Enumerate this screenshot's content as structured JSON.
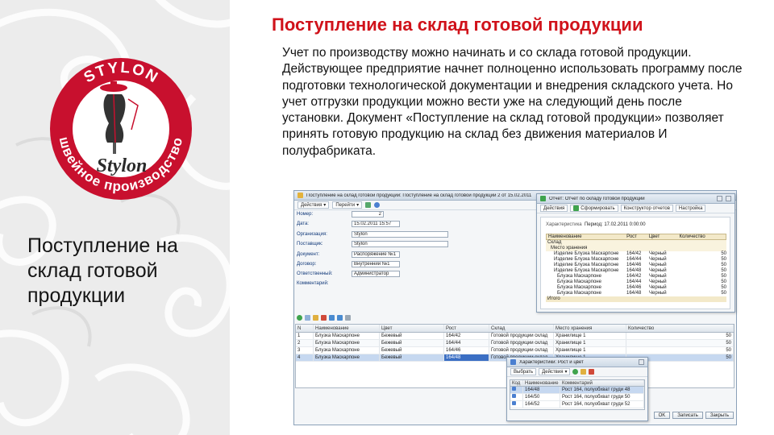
{
  "slide": {
    "title": "Поступление на склад готовой продукции",
    "side_title": "Поступление на склад готовой продукции",
    "body": "Учет по производству можно начинать и со склада готовой продукции. Действующее предприятие начнет полноценно использовать программу после подготовки технологической документации и внедрения складского учета. Но учет отгрузки продукции можно вести уже на следующий день после установки. Документ «Поступление на склад готовой продукции» позволяет принять готовую продукцию на склад без движения материалов И полуфабриката.",
    "accent_color": "#d0121a"
  },
  "logo": {
    "brand_top": "STYLON",
    "brand_script": "Stylon",
    "ring_text": "швейное производство",
    "ring_color": "#c8102e"
  },
  "doc_window": {
    "title": "Поступление на склад готовой продукции: Поступление на склад готовой продукции 2 от 15.02.2011",
    "toolbar": [
      "Действия",
      "Перейти"
    ],
    "fields": [
      {
        "label": "Номер:",
        "value": "2"
      },
      {
        "label": "Дата:",
        "value": "15.02.2011 15:57"
      },
      {
        "label": "Организация:",
        "value": "Stylon"
      },
      {
        "label": "Поставщик:",
        "value": "Stylon"
      },
      {
        "label": "Документ:",
        "value": "Распоряжение №1"
      },
      {
        "label": "Договор:",
        "value": "Внутренний №1"
      },
      {
        "label": "Ответственный:",
        "value": "Администратор"
      },
      {
        "label": "Комментарий:",
        "value": ""
      }
    ],
    "grid_headers": [
      "N",
      "Наименование",
      "Цвет",
      "Рост",
      "Склад",
      "Место хранения",
      "Количество"
    ],
    "grid_rows": [
      [
        "1",
        "Блузка Маскарпоне",
        "Бежевый",
        "164/42",
        "Готовой продукции склад",
        "Хранилище 1",
        "50"
      ],
      [
        "2",
        "Блузка Маскарпоне",
        "Бежевый",
        "164/44",
        "Готовой продукции склад",
        "Хранилище 1",
        "50"
      ],
      [
        "3",
        "Блузка Маскарпоне",
        "Бежевый",
        "164/46",
        "Готовой продукции склад",
        "Хранилище 1",
        "50"
      ],
      [
        "4",
        "Блузка Маскарпоне",
        "Бежевый",
        "164/48",
        "Готовой продукции склад",
        "Хранилище 1",
        "50"
      ]
    ]
  },
  "report_window": {
    "title": "Отчет: Отчет по складу готовой продукции",
    "toolbar": [
      "Действия",
      "Сформировать",
      "Конструктор отчетов",
      "Настройка"
    ],
    "period_label": "Характеристика",
    "period_value": "Период: 17.02.2011 0:00:00",
    "headers": [
      "Наименование",
      "Рост",
      "Цвет",
      "Количество"
    ],
    "groups": [
      "Склад",
      "Место хранения"
    ],
    "rows": [
      [
        "Изделие Блузка Маскарпоне",
        "164/42",
        "Черный",
        "50"
      ],
      [
        "Изделие Блузка Маскарпоне",
        "164/44",
        "Черный",
        "50"
      ],
      [
        "Изделие Блузка Маскарпоне",
        "164/46",
        "Черный",
        "50"
      ],
      [
        "Изделие Блузка Маскарпоне",
        "164/48",
        "Черный",
        "50"
      ],
      [
        "Блузка Маскарпоне",
        "164/42",
        "Черный",
        "50"
      ],
      [
        "Блузка Маскарпоне",
        "164/44",
        "Черный",
        "50"
      ],
      [
        "Блузка Маскарпоне",
        "164/46",
        "Черный",
        "50"
      ],
      [
        "Блузка Маскарпоне",
        "164/48",
        "Черный",
        "50"
      ]
    ],
    "total_label": "Итого"
  },
  "picker_window": {
    "title": "Характеристики: Рост и цвет",
    "toolbar": [
      "Выбрать",
      "Действия"
    ],
    "headers": [
      "Код",
      "Наименование",
      "Комментарий"
    ],
    "rows": [
      [
        "",
        "164/48",
        "Рост 164, полуобхват груди 48"
      ],
      [
        "",
        "164/50",
        "Рост 164, полуобхват груди 50"
      ],
      [
        "",
        "164/52",
        "Рост 164, полуобхват груди 52"
      ]
    ],
    "buttons": [
      "OK",
      "Записать",
      "Закрыть"
    ]
  }
}
